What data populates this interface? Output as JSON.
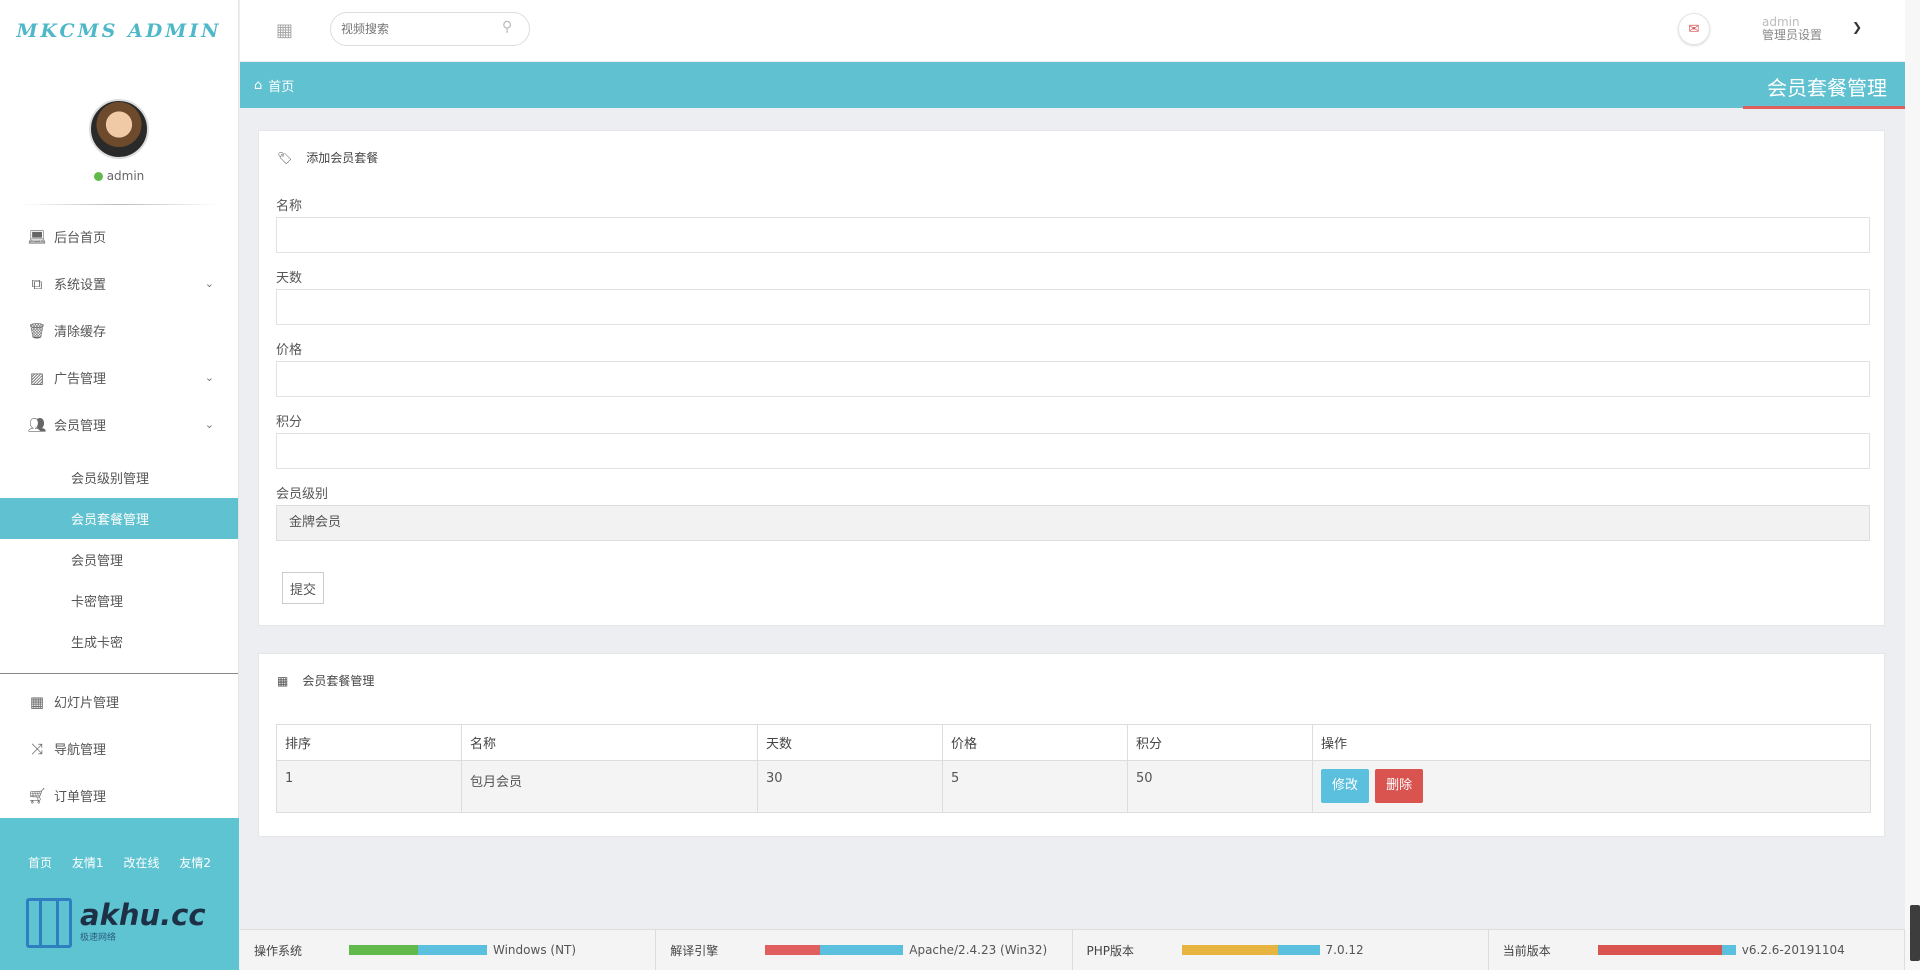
{
  "app": {
    "logo": "MKCMS ADMIN"
  },
  "sidebar": {
    "user": {
      "name": "admin"
    },
    "menu": [
      {
        "label": "后台首页",
        "icon": "laptop-icon"
      },
      {
        "label": "系统设置",
        "icon": "settings-icon"
      },
      {
        "label": "清除缓存",
        "icon": "trash-icon"
      },
      {
        "label": "广告管理",
        "icon": "image-icon"
      },
      {
        "label": "会员管理",
        "icon": "users-icon"
      }
    ],
    "submenu": [
      {
        "label": "会员级别管理"
      },
      {
        "label": "会员套餐管理",
        "active": true
      },
      {
        "label": "会员管理"
      },
      {
        "label": "卡密管理"
      },
      {
        "label": "生成卡密"
      }
    ],
    "menu2": [
      {
        "label": "幻灯片管理",
        "icon": "table-icon"
      },
      {
        "label": "导航管理",
        "icon": "shuffle-icon"
      },
      {
        "label": "订单管理",
        "icon": "cart-icon"
      }
    ],
    "footer_links": [
      "首页",
      "友情1",
      "改在线",
      "友情2"
    ],
    "brand": {
      "name": "akhu.cc",
      "sub": "极速网络"
    }
  },
  "header": {
    "search_placeholder": "视频搜索",
    "user_name": "admin",
    "user_role": "管理员设置"
  },
  "breadcrumb": {
    "home": "首页",
    "title": "会员套餐管理"
  },
  "form": {
    "heading": "添加会员套餐",
    "fields": {
      "name": {
        "label": "名称",
        "value": ""
      },
      "days": {
        "label": "天数",
        "value": ""
      },
      "price": {
        "label": "价格",
        "value": ""
      },
      "points": {
        "label": "积分",
        "value": ""
      },
      "level": {
        "label": "会员级别",
        "value": "金牌会员"
      }
    },
    "submit": "提交"
  },
  "table": {
    "heading": "会员套餐管理",
    "columns": [
      "排序",
      "名称",
      "天数",
      "价格",
      "积分",
      "操作"
    ],
    "rows": [
      {
        "order": "1",
        "name": "包月会员",
        "days": "30",
        "price": "5",
        "points": "50",
        "edit": "修改",
        "delete": "删除"
      }
    ]
  },
  "statusbar": [
    {
      "key": "操作系统",
      "value": "Windows (NT)",
      "fill": 0.5,
      "color": "#62b94b"
    },
    {
      "key": "解译引擎",
      "value": "Apache/2.4.23 (Win32)",
      "fill": 0.4,
      "color": "#e15e5e"
    },
    {
      "key": "PHP版本",
      "value": "7.0.12",
      "fill": 0.7,
      "color": "#e8b440"
    },
    {
      "key": "当前版本",
      "value": "v6.2.6-20191104",
      "fill": 0.9,
      "color": "#d9534f"
    }
  ]
}
